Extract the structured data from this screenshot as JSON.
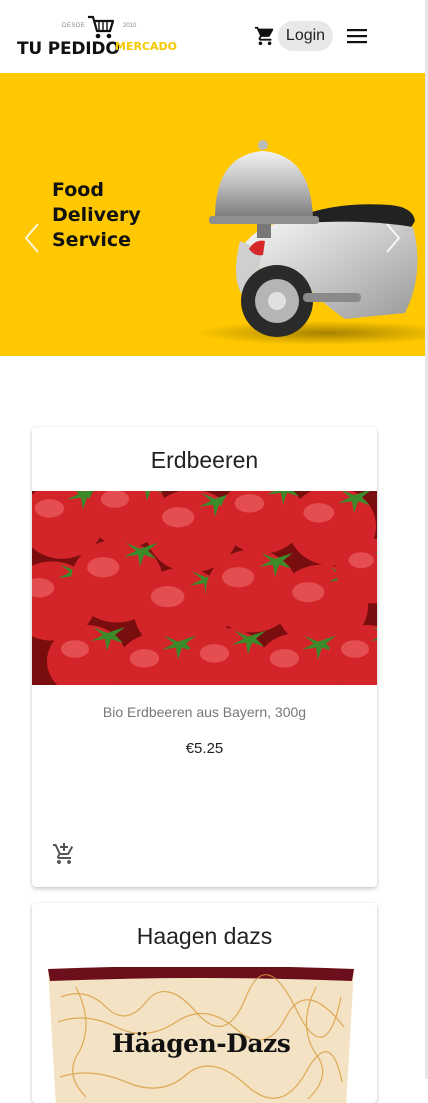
{
  "header": {
    "logo": {
      "desde": "DESDE",
      "year": "2010",
      "name": "TU PEDIDO",
      "suffix": "MERCADO"
    },
    "login_label": "Login",
    "cart_icon": "shopping-cart-icon",
    "menu_icon": "hamburger-menu-icon"
  },
  "hero": {
    "lines": [
      "Food",
      "Delivery",
      "Service"
    ],
    "background_color": "#ffc800"
  },
  "products": [
    {
      "title": "Erdbeeren",
      "description": "Bio Erdbeeren aus Bayern, 300g",
      "price": "€5.25",
      "action_icon": "add-shopping-cart-icon"
    },
    {
      "title": "Haagen dazs",
      "brand_text": "Häagen-Dazs"
    }
  ]
}
